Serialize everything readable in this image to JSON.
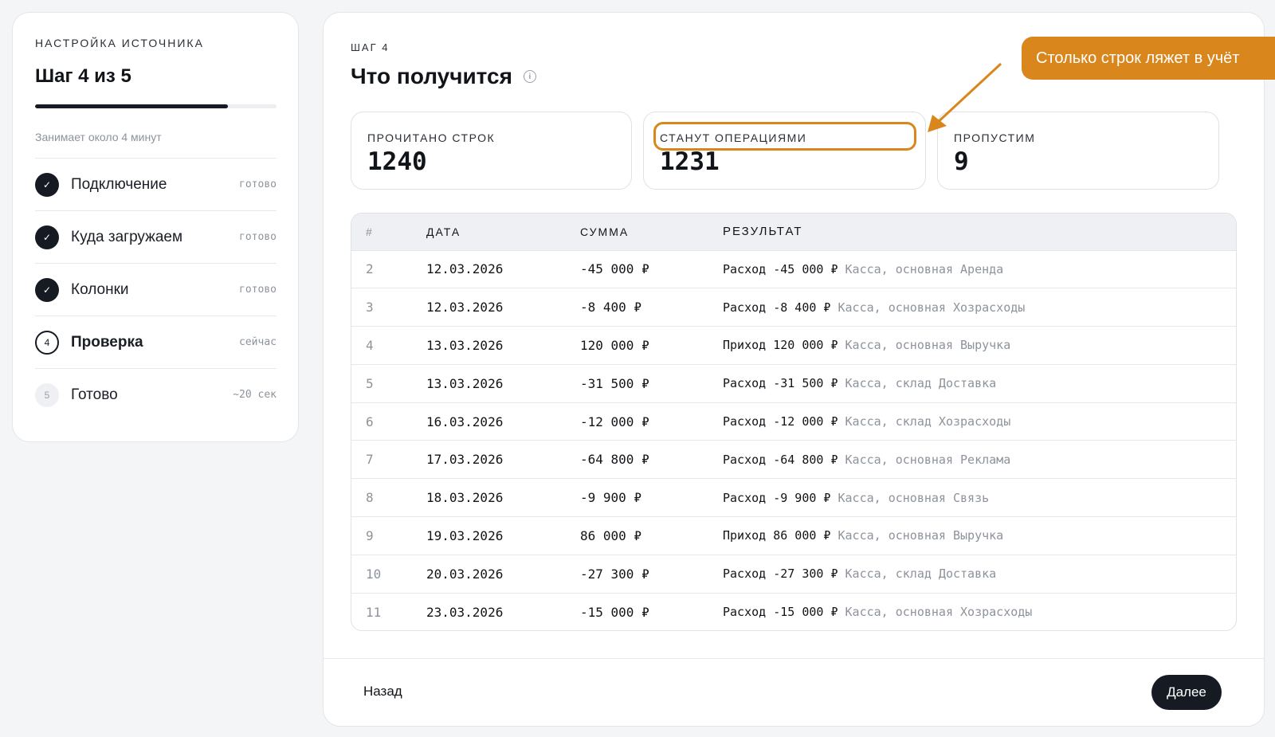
{
  "sidebar": {
    "eyebrow": "НАСТРОЙКА ИСТОЧНИКА",
    "title": "Шаг 4 из 5",
    "progress": 0.8,
    "hint": "Занимает около 4 минут",
    "steps": [
      {
        "label": "Подключение",
        "status": "готово",
        "state": "done",
        "marker": "✓"
      },
      {
        "label": "Куда загружаем",
        "status": "готово",
        "state": "done",
        "marker": "✓"
      },
      {
        "label": "Колонки",
        "status": "готово",
        "state": "done",
        "marker": "✓"
      },
      {
        "label": "Проверка",
        "status": "сейчас",
        "state": "current",
        "marker": "4"
      },
      {
        "label": "Готово",
        "status": "~20 сек",
        "state": "pending",
        "marker": "5"
      }
    ]
  },
  "main": {
    "eyebrow": "ШАГ 4",
    "title": "Что получится",
    "info_icon": "i",
    "stats": {
      "read": {
        "label": "ПРОЧИТАНО СТРОК",
        "value": "1240"
      },
      "ops": {
        "label": "СТАНУТ ОПЕРАЦИЯМИ",
        "value": "1231"
      },
      "skip": {
        "label": "ПРОПУСТИМ",
        "value": "9"
      }
    },
    "table": {
      "headers": [
        "#",
        "ДАТА",
        "СУММА",
        "РЕЗУЛЬТАТ"
      ],
      "rows": [
        {
          "n": "2",
          "date": "12.03.2026",
          "sum": "-45 000 ₽",
          "res": "Расход -45 000 ₽",
          "res_muted": "Касса, основная Аренда"
        },
        {
          "n": "3",
          "date": "12.03.2026",
          "sum": "-8 400 ₽",
          "res": "Расход -8 400 ₽",
          "res_muted": "Касса, основная Хозрасходы"
        },
        {
          "n": "4",
          "date": "13.03.2026",
          "sum": "120 000 ₽",
          "res": "Приход 120 000 ₽",
          "res_muted": "Касса, основная Выручка"
        },
        {
          "n": "5",
          "date": "13.03.2026",
          "sum": "-31 500 ₽",
          "res": "Расход -31 500 ₽",
          "res_muted": "Касса, склад Доставка"
        },
        {
          "n": "6",
          "date": "16.03.2026",
          "sum": "-12 000 ₽",
          "res": "Расход -12 000 ₽",
          "res_muted": "Касса, склад Хозрасходы"
        },
        {
          "n": "7",
          "date": "17.03.2026",
          "sum": "-64 800 ₽",
          "res": "Расход -64 800 ₽",
          "res_muted": "Касса, основная Реклама"
        },
        {
          "n": "8",
          "date": "18.03.2026",
          "sum": "-9 900 ₽",
          "res": "Расход -9 900 ₽",
          "res_muted": "Касса, основная Связь"
        },
        {
          "n": "9",
          "date": "19.03.2026",
          "sum": "86 000 ₽",
          "res": "Приход 86 000 ₽",
          "res_muted": "Касса, основная Выручка"
        },
        {
          "n": "10",
          "date": "20.03.2026",
          "sum": "-27 300 ₽",
          "res": "Расход -27 300 ₽",
          "res_muted": "Касса, склад Доставка"
        },
        {
          "n": "11",
          "date": "23.03.2026",
          "sum": "-15 000 ₽",
          "res": "Расход -15 000 ₽",
          "res_muted": "Касса, основная Хозрасходы"
        }
      ]
    },
    "footer": {
      "back_label": "Назад",
      "next_label": "Далее"
    }
  },
  "callout": {
    "text": "Столько строк ляжет в учёт",
    "color": "#d9871c"
  },
  "colors": {
    "accent": "#151a23",
    "highlight": "#d9871c",
    "muted": "#8d939c"
  }
}
